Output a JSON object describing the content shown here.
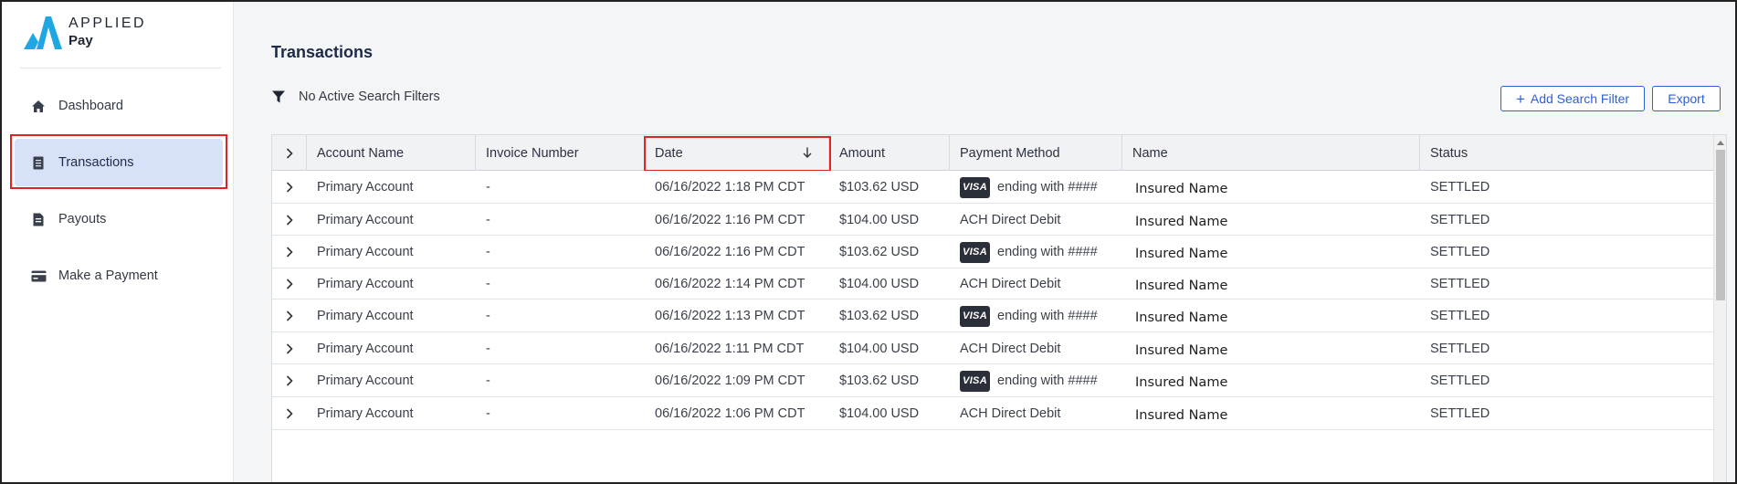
{
  "brand": {
    "line1": "APPLIED",
    "line2": "Pay",
    "colors": {
      "primary": "#1ea7e1",
      "accent": "#2e5fd6"
    }
  },
  "sidebar": {
    "items": [
      {
        "label": "Dashboard",
        "icon": "home-icon"
      },
      {
        "label": "Transactions",
        "icon": "receipt-icon",
        "active": true
      },
      {
        "label": "Payouts",
        "icon": "document-icon"
      },
      {
        "label": "Make a Payment",
        "icon": "credit-card-icon"
      }
    ]
  },
  "main": {
    "title": "Transactions",
    "filter_text": "No Active Search Filters",
    "add_filter_label": "Add Search Filter",
    "export_label": "Export"
  },
  "table": {
    "columns": [
      "Account Name",
      "Invoice Number",
      "Date",
      "Amount",
      "Payment Method",
      "Name",
      "Status"
    ],
    "sorted_column": "Date",
    "sort_direction": "descending",
    "rows": [
      {
        "account": "Primary Account",
        "invoice": "-",
        "date": "06/16/2022 1:18 PM CDT",
        "amount": "$103.62 USD",
        "method_type": "visa",
        "method": "ending with ####",
        "name": "Insured Name",
        "status": "SETTLED"
      },
      {
        "account": "Primary Account",
        "invoice": "-",
        "date": "06/16/2022 1:16 PM CDT",
        "amount": "$104.00 USD",
        "method_type": "ach",
        "method": "ACH Direct Debit",
        "name": "Insured Name",
        "status": "SETTLED"
      },
      {
        "account": "Primary Account",
        "invoice": "-",
        "date": "06/16/2022 1:16 PM CDT",
        "amount": "$103.62 USD",
        "method_type": "visa",
        "method": "ending with ####",
        "name": "Insured Name",
        "status": "SETTLED"
      },
      {
        "account": "Primary Account",
        "invoice": "-",
        "date": "06/16/2022 1:14 PM CDT",
        "amount": "$104.00 USD",
        "method_type": "ach",
        "method": "ACH Direct Debit",
        "name": "Insured Name",
        "status": "SETTLED"
      },
      {
        "account": "Primary Account",
        "invoice": "-",
        "date": "06/16/2022 1:13 PM CDT",
        "amount": "$103.62 USD",
        "method_type": "visa",
        "method": "ending with ####",
        "name": "Insured Name",
        "status": "SETTLED"
      },
      {
        "account": "Primary Account",
        "invoice": "-",
        "date": "06/16/2022 1:11 PM CDT",
        "amount": "$104.00 USD",
        "method_type": "ach",
        "method": "ACH Direct Debit",
        "name": "Insured Name",
        "status": "SETTLED"
      },
      {
        "account": "Primary Account",
        "invoice": "-",
        "date": "06/16/2022 1:09 PM CDT",
        "amount": "$103.62 USD",
        "method_type": "visa",
        "method": "ending with ####",
        "name": "Insured Name",
        "status": "SETTLED"
      },
      {
        "account": "Primary Account",
        "invoice": "-",
        "date": "06/16/2022 1:06 PM CDT",
        "amount": "$104.00 USD",
        "method_type": "ach",
        "method": "ACH Direct Debit",
        "name": "Insured Name",
        "status": "SETTLED"
      }
    ],
    "visa_badge": "VISA"
  },
  "annotations": {
    "highlight_color": "#e02424"
  }
}
